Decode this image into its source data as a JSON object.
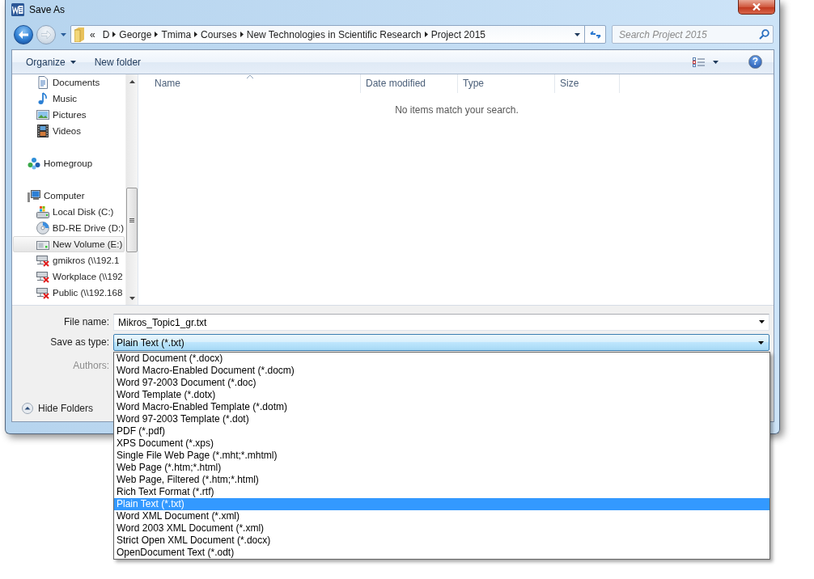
{
  "window": {
    "title": "Save As"
  },
  "navigation": {
    "overflow": "«",
    "path": [
      "D",
      "George",
      "Tmima",
      "Courses",
      "New Technologies in Scientific Research",
      "Project 2015"
    ],
    "search_placeholder": "Search Project 2015"
  },
  "toolbar": {
    "organize": "Organize",
    "new_folder": "New folder",
    "help": "?"
  },
  "sidebar": {
    "items": [
      {
        "children": [
          {
            "label": "Documents",
            "kind": "documents",
            "selected": false
          },
          {
            "label": "Music",
            "kind": "music",
            "selected": false
          },
          {
            "label": "Pictures",
            "kind": "pictures",
            "selected": false
          },
          {
            "label": "Videos",
            "kind": "videos",
            "selected": false
          }
        ]
      },
      {
        "label": "Homegroup",
        "kind": "homegroup",
        "selected": false
      },
      {
        "label": "Computer",
        "kind": "computer",
        "selected": false,
        "children": [
          {
            "label": "Local Disk (C:)",
            "kind": "disk",
            "selected": false
          },
          {
            "label": "BD-RE Drive (D:)",
            "kind": "optical",
            "selected": false
          },
          {
            "label": "New Volume (E:)",
            "kind": "volume",
            "selected": true
          },
          {
            "label": "gmikros (\\\\192.1",
            "kind": "network",
            "selected": false
          },
          {
            "label": "Workplace (\\\\192",
            "kind": "network",
            "selected": false
          },
          {
            "label": "Public (\\\\192.168",
            "kind": "network",
            "selected": false
          }
        ]
      }
    ]
  },
  "table": {
    "columns": [
      {
        "label": "Name",
        "sorted": true
      },
      {
        "label": "Date modified",
        "sorted": false
      },
      {
        "label": "Type",
        "sorted": false
      },
      {
        "label": "Size",
        "sorted": false
      }
    ],
    "empty_message": "No items match your search."
  },
  "form": {
    "fields": [
      {
        "label": "File name:",
        "kind": "combo",
        "value": "Mikros_Topic1_gr.txt",
        "disabled": false
      },
      {
        "label": "Save as type:",
        "kind": "select",
        "value": "Plain Text (*.txt)",
        "disabled": false,
        "expanded": true,
        "options": [
          {
            "label": "Word Document (*.docx)",
            "selected": false
          },
          {
            "label": "Word Macro-Enabled Document (*.docm)",
            "selected": false
          },
          {
            "label": "Word 97-2003 Document (*.doc)",
            "selected": false
          },
          {
            "label": "Word Template (*.dotx)",
            "selected": false
          },
          {
            "label": "Word Macro-Enabled Template (*.dotm)",
            "selected": false
          },
          {
            "label": "Word 97-2003 Template (*.dot)",
            "selected": false
          },
          {
            "label": "PDF (*.pdf)",
            "selected": false
          },
          {
            "label": "XPS Document (*.xps)",
            "selected": false
          },
          {
            "label": "Single File Web Page (*.mht;*.mhtml)",
            "selected": false
          },
          {
            "label": "Web Page (*.htm;*.html)",
            "selected": false
          },
          {
            "label": "Web Page, Filtered (*.htm;*.html)",
            "selected": false
          },
          {
            "label": "Rich Text Format (*.rtf)",
            "selected": false
          },
          {
            "label": "Plain Text (*.txt)",
            "selected": true
          },
          {
            "label": "Word XML Document (*.xml)",
            "selected": false
          },
          {
            "label": "Word 2003 XML Document (*.xml)",
            "selected": false
          },
          {
            "label": "Strict Open XML Document (*.docx)",
            "selected": false
          },
          {
            "label": "OpenDocument Text (*.odt)",
            "selected": false
          }
        ]
      },
      {
        "label": "Authors:",
        "kind": "metadata",
        "disabled": true
      }
    ]
  },
  "hide_folders": "Hide Folders"
}
